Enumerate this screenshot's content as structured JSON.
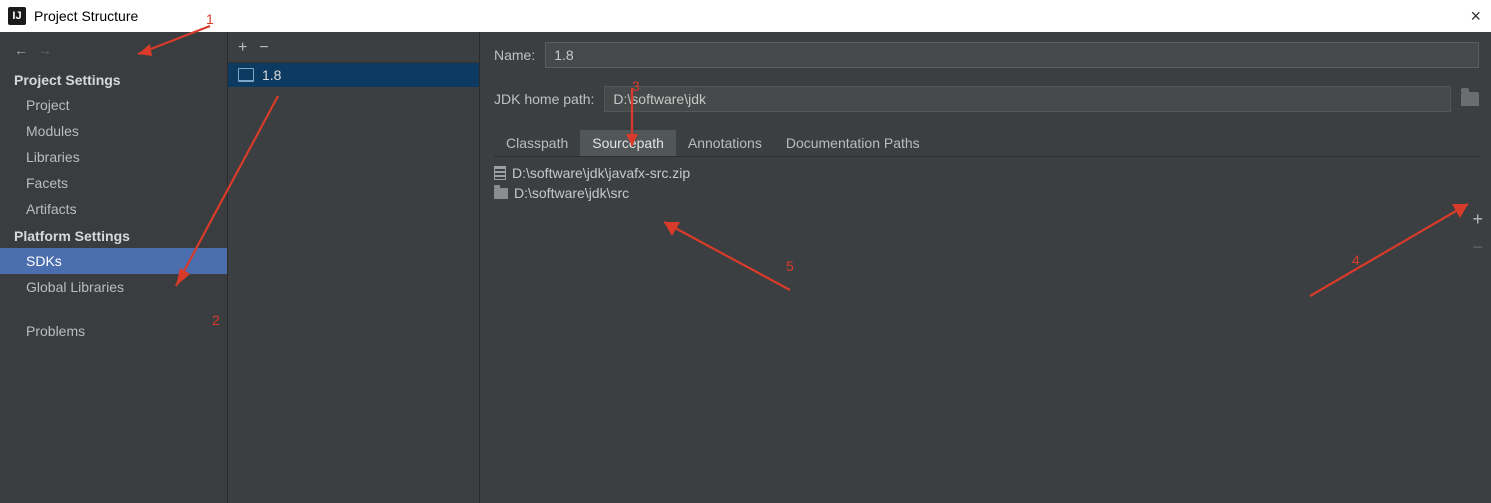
{
  "window": {
    "title": "Project Structure",
    "close_label": "×"
  },
  "sidebar": {
    "back_icon": "←",
    "fwd_icon": "→",
    "section1_label": "Project Settings",
    "section2_label": "Platform Settings",
    "items1": [
      {
        "label": "Project"
      },
      {
        "label": "Modules"
      },
      {
        "label": "Libraries"
      },
      {
        "label": "Facets"
      },
      {
        "label": "Artifacts"
      }
    ],
    "items2": [
      {
        "label": "SDKs",
        "selected": true
      },
      {
        "label": "Global Libraries"
      }
    ],
    "items3": [
      {
        "label": "Problems"
      }
    ]
  },
  "middle": {
    "add_icon": "+",
    "remove_icon": "−",
    "sdk_label": "1.8"
  },
  "main": {
    "name_label": "Name:",
    "name_value": "1.8",
    "path_label": "JDK home path:",
    "path_value": "D:\\software\\jdk",
    "tabs": [
      {
        "label": "Classpath"
      },
      {
        "label": "Sourcepath",
        "active": true
      },
      {
        "label": "Annotations"
      },
      {
        "label": "Documentation Paths"
      }
    ],
    "sources": [
      {
        "label": "D:\\software\\jdk\\javafx-src.zip",
        "kind": "zip"
      },
      {
        "label": "D:\\software\\jdk\\src",
        "kind": "folder"
      }
    ],
    "right_add": "+",
    "right_remove": "−"
  },
  "annotations": {
    "n1": "1",
    "n2": "2",
    "n3": "3",
    "n4": "4",
    "n5": "5"
  }
}
